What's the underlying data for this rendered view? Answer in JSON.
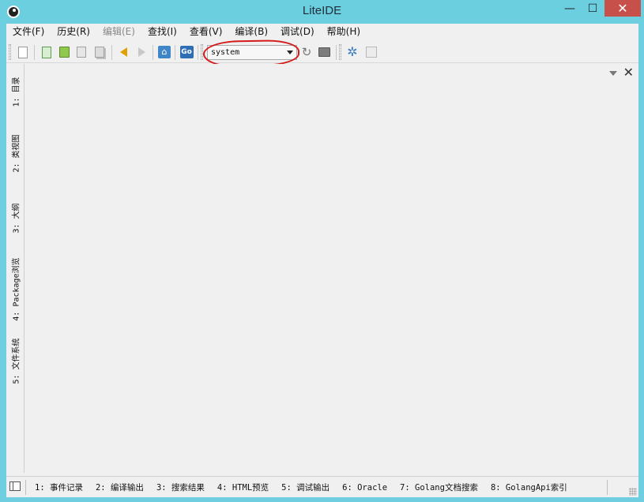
{
  "window": {
    "title": "LiteIDE",
    "minimize_glyph": "—",
    "maximize_glyph": "☐",
    "close_glyph": "✕"
  },
  "menu": {
    "items": [
      {
        "label": "文件(F)",
        "enabled": true
      },
      {
        "label": "历史(R)",
        "enabled": true
      },
      {
        "label": "编辑(E)",
        "enabled": false
      },
      {
        "label": "查找(I)",
        "enabled": true
      },
      {
        "label": "查看(V)",
        "enabled": true
      },
      {
        "label": "编译(B)",
        "enabled": true
      },
      {
        "label": "调试(D)",
        "enabled": true
      },
      {
        "label": "帮助(H)",
        "enabled": true
      }
    ]
  },
  "toolbar": {
    "environment_value": "system",
    "home_glyph": "⌂",
    "go_label": "Go",
    "reload_glyph": "↻",
    "settings_glyph": "✲",
    "icons": [
      "new-file-icon",
      "open-file-icon",
      "open-folder-icon",
      "save-icon",
      "save-all-icon",
      "back-icon",
      "forward-icon",
      "home-icon",
      "go-icon",
      "reload-icon",
      "terminal-icon",
      "settings-icon",
      "blank-icon"
    ]
  },
  "annotation": {
    "color": "#d41a1a",
    "shape": "hand-drawn-ellipse"
  },
  "left_panel": {
    "tabs": [
      {
        "label": "1: 目录"
      },
      {
        "label": "2: 类视图"
      },
      {
        "label": "3: 大纲"
      },
      {
        "label": "4: Package浏览"
      },
      {
        "label": "5: 文件系统"
      }
    ]
  },
  "main_pane": {
    "close_glyph": "✕"
  },
  "bottom_panel": {
    "tabs": [
      {
        "label": "1: 事件记录"
      },
      {
        "label": "2: 编译输出"
      },
      {
        "label": "3: 搜索结果"
      },
      {
        "label": "4: HTML预览"
      },
      {
        "label": "5: 调试输出"
      },
      {
        "label": "6: Oracle"
      },
      {
        "label": "7: Golang文档搜索"
      },
      {
        "label": "8: GolangApi索引"
      }
    ]
  },
  "colors": {
    "titlebar": "#6ccfe0",
    "close_button": "#c7504b",
    "client_background": "#f0f0f0"
  }
}
